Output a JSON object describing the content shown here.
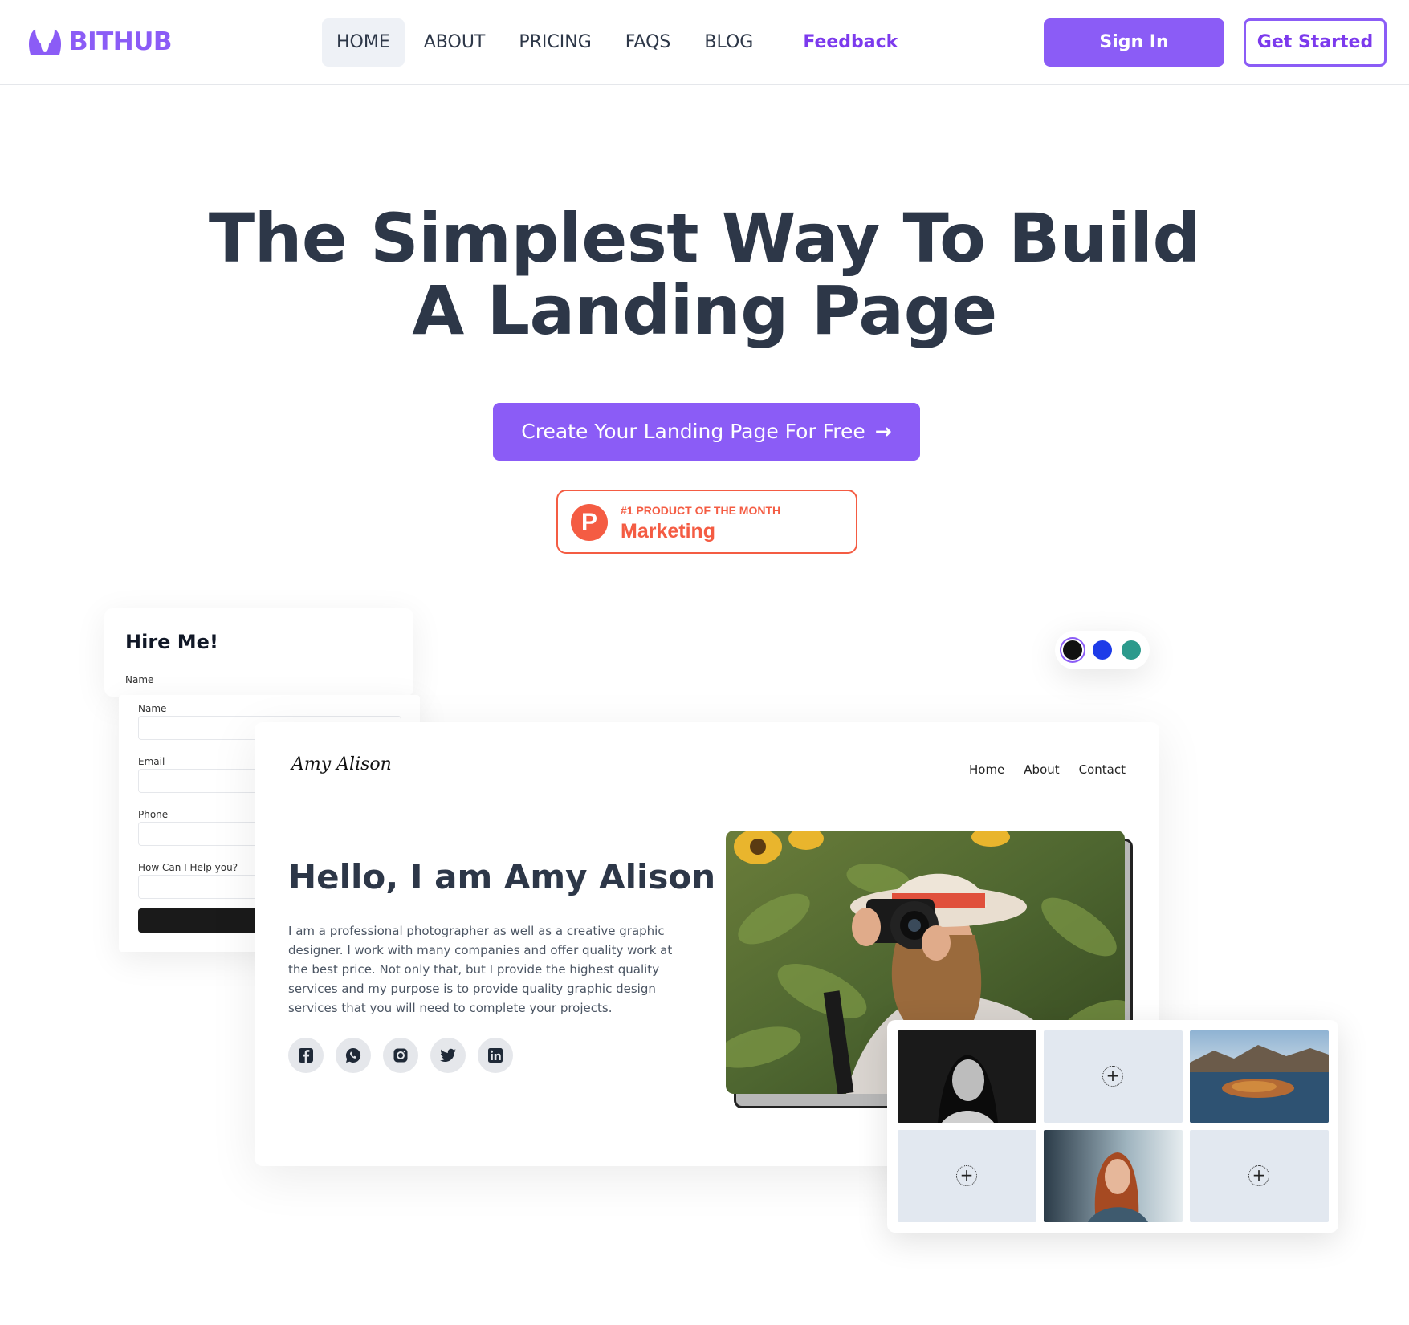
{
  "header": {
    "logo_text": "BITHUB",
    "nav": [
      {
        "label": "HOME",
        "active": true
      },
      {
        "label": "ABOUT"
      },
      {
        "label": "PRICING"
      },
      {
        "label": "FAQS"
      },
      {
        "label": "BLOG"
      },
      {
        "label": "Feedback"
      }
    ],
    "sign_in": "Sign In",
    "get_started": "Get Started"
  },
  "hero": {
    "title_line1": "The Simplest Way To Build",
    "title_line2": "A Landing Page",
    "cta": "Create Your Landing Page For Free",
    "badge": {
      "letter": "P",
      "small": "#1 PRODUCT OF THE MONTH",
      "big": "Marketing"
    }
  },
  "hire_form": {
    "title": "Hire Me!",
    "back_label": "Name",
    "labels": [
      "Name",
      "Email",
      "Phone",
      "How Can I Help you?"
    ]
  },
  "preview": {
    "logo": "Amy Alison",
    "nav": [
      "Home",
      "About",
      "Contact"
    ],
    "heading": "Hello, I am Amy Alison",
    "text": "I am a professional photographer as well as a creative graphic designer. I work with many companies and offer quality work at the best price. Not only that, but I provide the highest quality services and my purpose is to provide quality graphic design services that you will need to complete your projects.",
    "socials": [
      "facebook-icon",
      "whatsapp-icon",
      "instagram-icon",
      "twitter-icon",
      "linkedin-icon"
    ]
  },
  "gallery": {
    "cells": [
      "portrait-bw-photo",
      "add-image-icon",
      "lake-island-photo",
      "add-image-icon",
      "portrait-redhead-photo",
      "add-image-icon"
    ]
  },
  "swatches": [
    "#111111",
    "#1d3be8",
    "#2c9a8c"
  ],
  "colors": {
    "brand": "#8b5cf6",
    "brand_text": "#7c3aed",
    "heading": "#2d3748",
    "product_hunt": "#f45c43"
  }
}
